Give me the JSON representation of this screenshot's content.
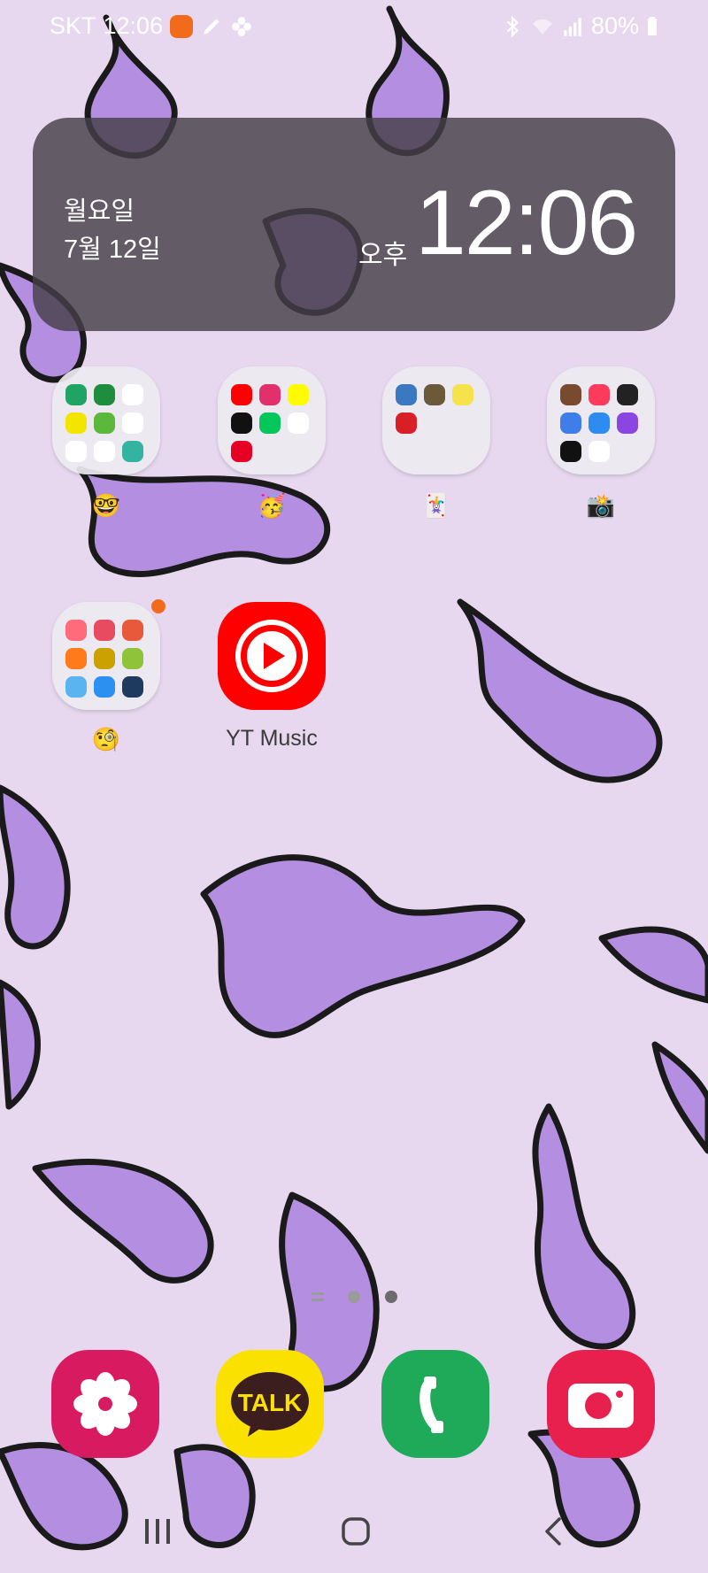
{
  "status_bar": {
    "carrier": "SKT",
    "time": "12:06",
    "battery": "80%",
    "left_icons": [
      "mi-app-icon",
      "pen-icon",
      "pinwheel-icon"
    ],
    "right_icons": [
      "bluetooth-icon",
      "wifi-icon",
      "signal-icon",
      "battery-icon"
    ]
  },
  "clock_widget": {
    "day": "월요일",
    "date": "7월 12일",
    "ampm": "오후",
    "time": "12:06"
  },
  "folders": [
    {
      "label": "🤓",
      "apps": [
        "#1fa463",
        "#1e8e3e",
        "#ffffff",
        "#f2e600",
        "#5bb83a",
        "#ffffff",
        "#ffffff",
        "#ffffff",
        "#34b3a0"
      ]
    },
    {
      "label": "🥳",
      "apps": [
        "#ff0000",
        "#e1306c",
        "#fffc00",
        "#111111",
        "#03c75a",
        "#ffffff",
        "#e60023"
      ]
    },
    {
      "label": "🃏",
      "apps": [
        "#3a78c2",
        "#6b5a3a",
        "#f6e24a",
        "#d81f26"
      ]
    },
    {
      "label": "📸",
      "apps": [
        "#7a4a2f",
        "#ff3b5c",
        "#222222",
        "#3f7de8",
        "#2e8cf0",
        "#8b45e0",
        "#111111",
        "#ffffff"
      ]
    },
    {
      "label": "🧐",
      "apps": [
        "#ff6b7a",
        "#e84a5f",
        "#e8583a",
        "#ff7a1a",
        "#caa100",
        "#8fc43a",
        "#59b4f0",
        "#2b90f0",
        "#1e3a5f"
      ]
    }
  ],
  "dock_apps": [
    {
      "name": "Gallery",
      "color": "#d81b60"
    },
    {
      "name": "KakaoTalk",
      "color": "#fae100",
      "text": "TALK"
    },
    {
      "name": "Phone",
      "color": "#1faa59"
    },
    {
      "name": "Camera",
      "color": "#e8204e"
    }
  ],
  "home_apps": [
    {
      "label": "YT Music",
      "color": "#ff0000"
    }
  ],
  "accent": "#f26a1b"
}
